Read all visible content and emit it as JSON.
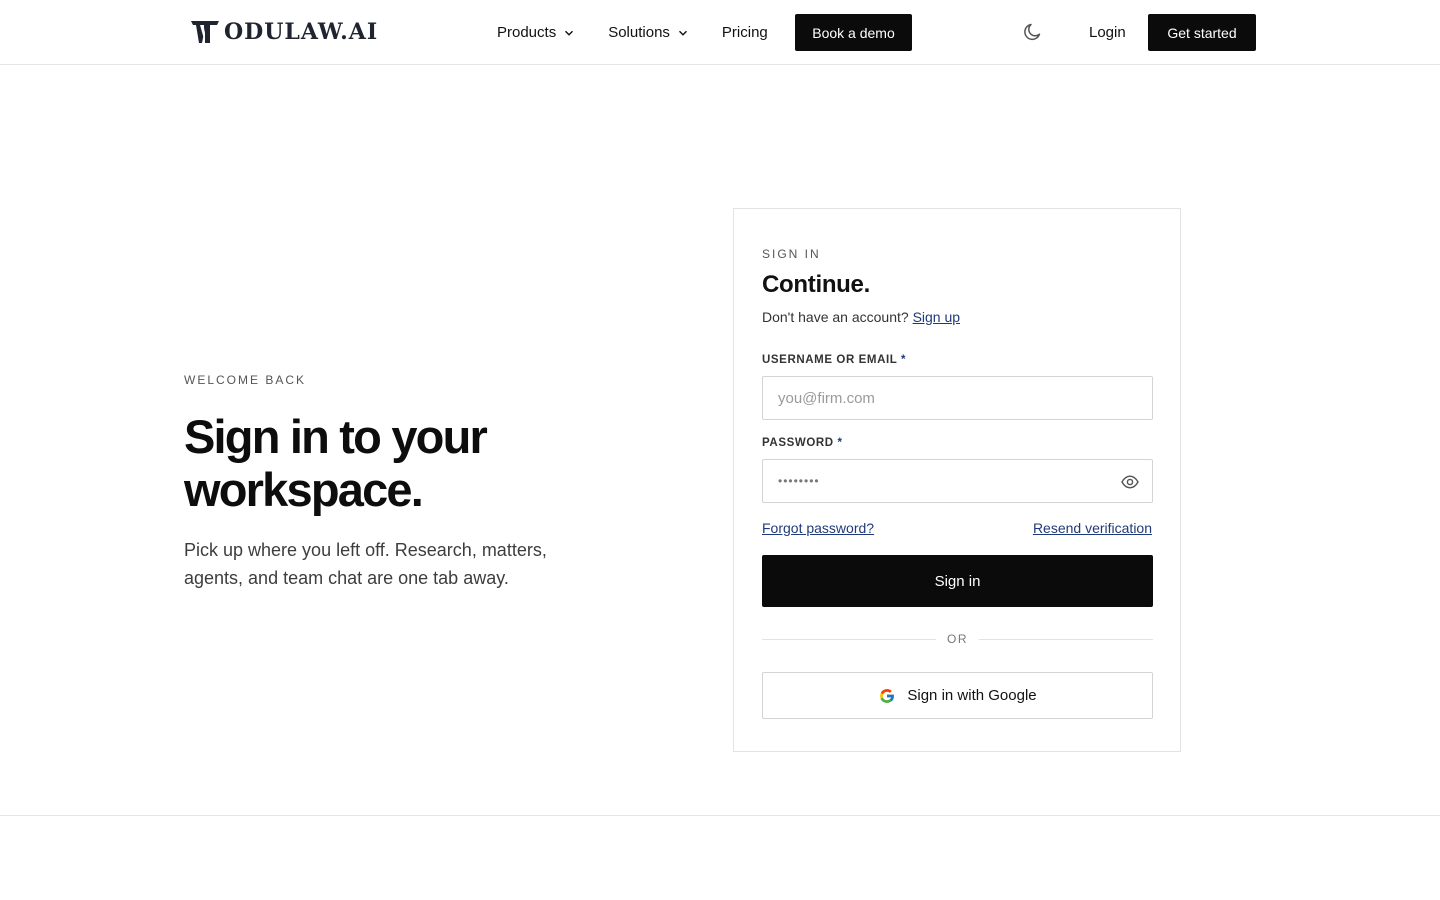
{
  "brand": {
    "name": "ODULAW.AI"
  },
  "nav": {
    "products": "Products",
    "solutions": "Solutions",
    "pricing": "Pricing",
    "book_demo": "Book a demo",
    "login": "Login",
    "get_started": "Get started",
    "theme_icon": "moon-icon"
  },
  "hero": {
    "eyebrow": "WELCOME BACK",
    "title": "Sign in to your workspace.",
    "subtitle": "Pick up where you left off. Research, matters, agents, and team chat are one tab away."
  },
  "signin": {
    "eyebrow": "SIGN IN",
    "title": "Continue.",
    "no_account": "Don't have an account?",
    "signup_link": "Sign up",
    "username_label": "USERNAME OR EMAIL",
    "username_placeholder": "you@firm.com",
    "username_value": "",
    "password_label": "PASSWORD",
    "password_masked": "••••••••",
    "required_mark": "*",
    "forgot": "Forgot password?",
    "resend": "Resend verification",
    "submit": "Sign in",
    "or": "OR",
    "google": "Sign in with Google"
  },
  "colors": {
    "primary_button": "#0b0b0b",
    "link": "#1f3a7a",
    "border": "#e3e3e3"
  }
}
